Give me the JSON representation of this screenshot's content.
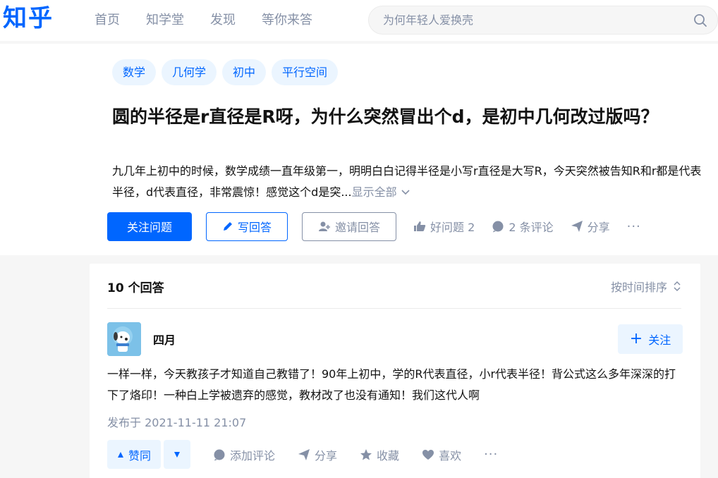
{
  "header": {
    "logo": "知乎",
    "nav": [
      "首页",
      "知学堂",
      "发现",
      "等你来答"
    ],
    "search_placeholder": "为何年轻人爱换壳"
  },
  "question": {
    "topics": [
      "数学",
      "几何学",
      "初中",
      "平行空间"
    ],
    "title": "圆的半径是r直径是R呀，为什么突然冒出个d，是初中几何改过版吗？",
    "detail": "九几年上初中的时候，数学成绩一直年级第一，明明白白记得半径是小写r直径是大写R，今天突然被告知R和r都是代表半径，d代表直径，非常震惊！感觉这个d是突...",
    "show_all": "显示全部",
    "follow": "关注问题",
    "write_answer": "写回答",
    "invite": "邀请回答",
    "good_question": "好问题 2",
    "comments": "2 条评论",
    "share": "分享",
    "more": "···"
  },
  "answers": {
    "count": "10 个回答",
    "sort": "按时间排序",
    "items": [
      {
        "author": "四月",
        "follow": "关注",
        "content": "一样一样，今天教孩子才知道自己教错了！90年上初中，学的R代表直径，小r代表半径！背公式这么多年深深的打下了烙印！一种白上学被遗弃的感觉，教材改了也没有通知！我们这代人啊",
        "time": "发布于 2021-11-11 21:07",
        "vote": "赞同",
        "add_comment": "添加评论",
        "share": "分享",
        "favorite": "收藏",
        "like": "喜欢",
        "more": "···"
      }
    ]
  },
  "colors": {
    "brand": "#0066ff",
    "muted": "#8590a6",
    "tag_bg": "#ebf5ff"
  }
}
